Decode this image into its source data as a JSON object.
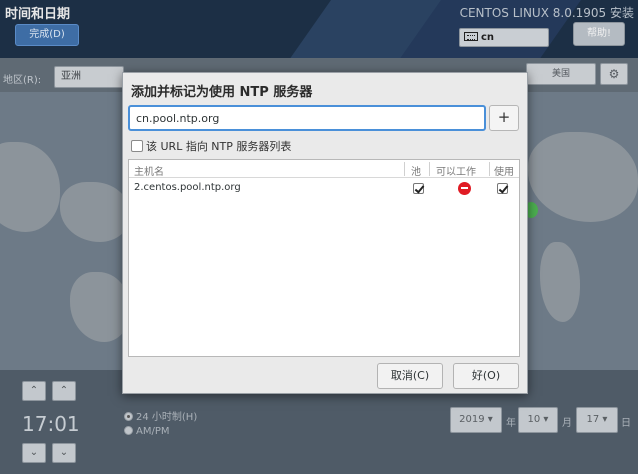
{
  "header": {
    "title": "时间和日期",
    "done_label": "完成(D)",
    "product_name": "CENTOS LINUX 8.0.1905 安装",
    "keyboard_layout": "cn",
    "help_label": "帮助!"
  },
  "filters": {
    "region_label": "地区(R):",
    "region_value": "亚洲",
    "city_button": "美国"
  },
  "time_panel": {
    "up_arrow": "⌃",
    "down_arrow": "⌄",
    "time_value": "17:01",
    "format_24h_label": "24 小时制(H)",
    "format_ampm_label": "AM/PM",
    "selected_format": "24h"
  },
  "date_panel": {
    "year_value": "2019 ▾",
    "year_label": "年",
    "month_value": "10 ▾",
    "month_label": "月",
    "day_value": "17 ▾",
    "day_label": "日"
  },
  "dialog": {
    "title": "添加并标记为使用 NTP 服务器",
    "server_input_value": "cn.pool.ntp.org",
    "add_button_label": "+",
    "url_checkbox_label": "该 URL 指向 NTP 服务器列表",
    "url_checkbox_checked": false,
    "columns": {
      "host": "主机名",
      "pool": "池",
      "working": "可以工作",
      "use": "使用"
    },
    "servers": [
      {
        "host": "2.centos.pool.ntp.org",
        "pool": true,
        "working": false,
        "use": true
      }
    ],
    "cancel_label": "取消(C)",
    "ok_label": "好(O)"
  },
  "colors": {
    "focus_ring": "#4a90d9",
    "not_working_red": "#e01b24",
    "header_bg": "#1c2f45"
  }
}
